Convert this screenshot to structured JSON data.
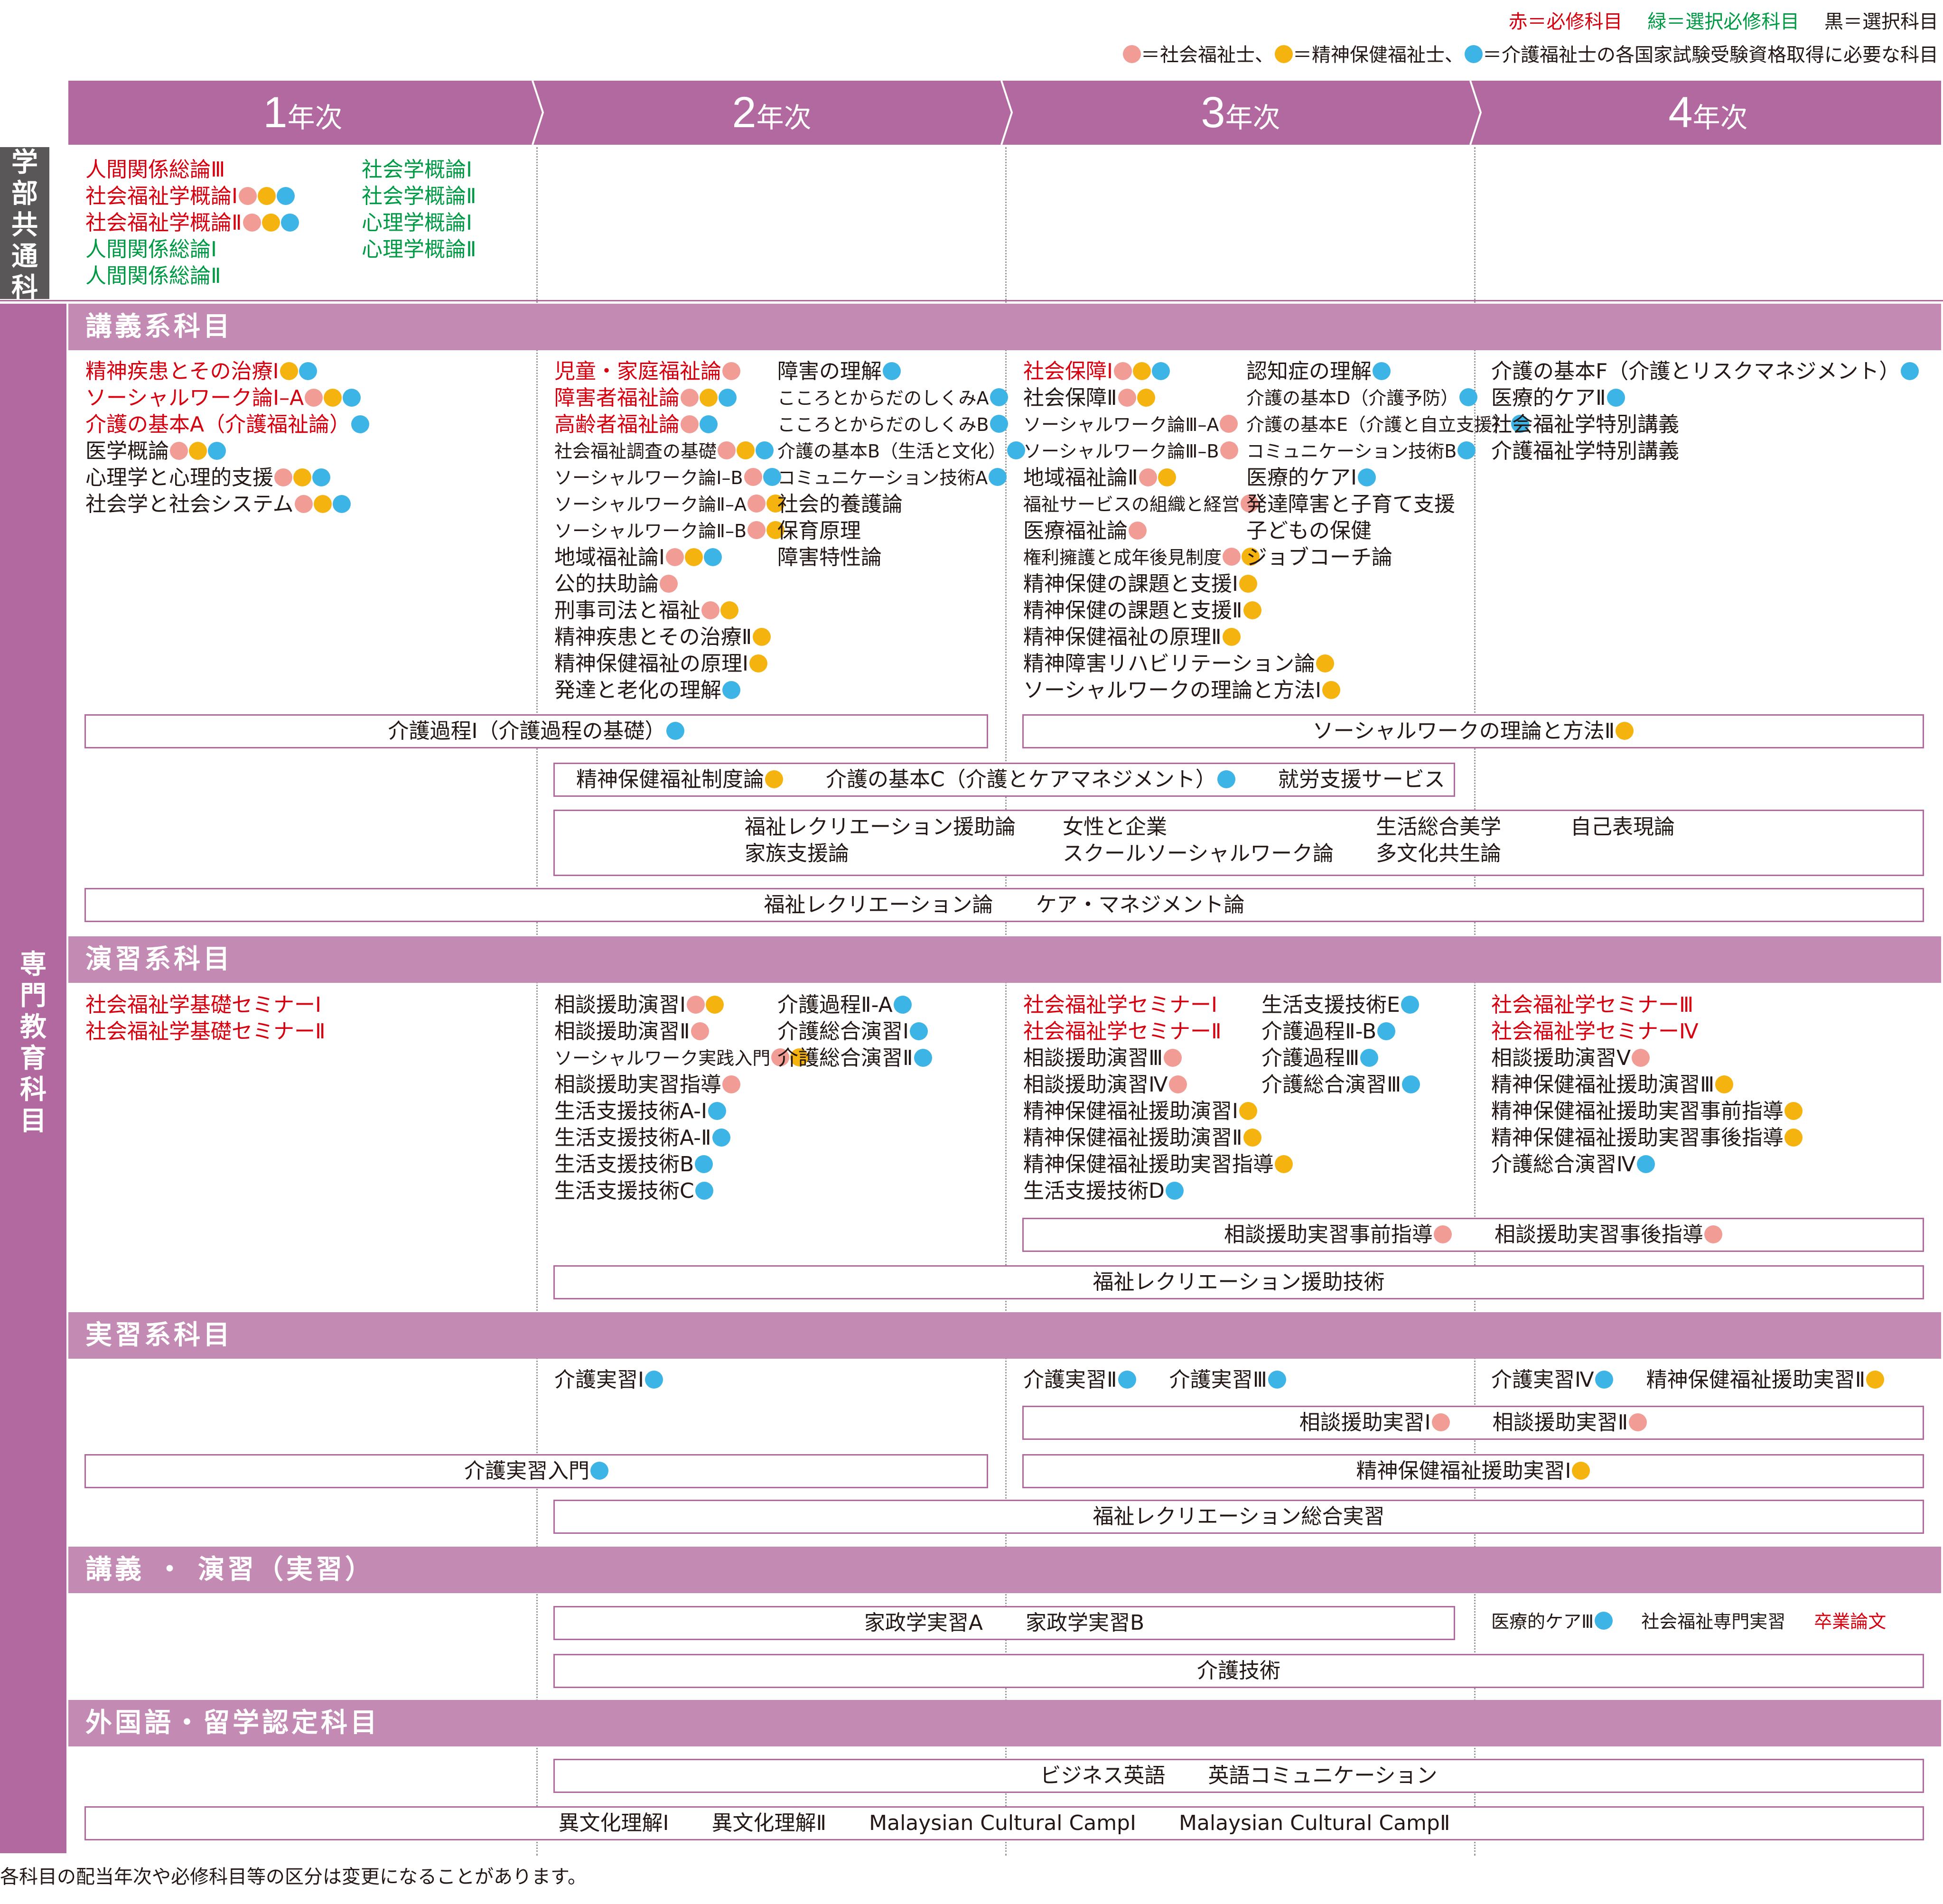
{
  "legend": {
    "line1": {
      "red": "赤＝必修科目",
      "green": "緑＝選択必修科目",
      "black": "黒＝選択科目"
    },
    "line2": {
      "pink_text": "＝社会福祉士、",
      "yellow_text": "＝精神保健福祉士、",
      "blue_text": "＝介護福祉士の各国家試験受験資格取得に必要な科目"
    }
  },
  "colors": {
    "required": "#d7000f",
    "elective_required": "#009a44",
    "elective": "#231815",
    "pink_dot": "#f19c94",
    "yellow_dot": "#f5b30f",
    "blue_dot": "#3db4e6",
    "header": "#b2699f",
    "category": "#c38ab4"
  },
  "dot_meaning": {
    "p": "社会福祉士",
    "y": "精神保健福祉士",
    "b": "介護福祉士"
  },
  "years": [
    {
      "num": "1",
      "suffix": "年次"
    },
    {
      "num": "2",
      "suffix": "年次"
    },
    {
      "num": "3",
      "suffix": "年次"
    },
    {
      "num": "4",
      "suffix": "年次"
    }
  ],
  "side": {
    "common": "学部共通科目",
    "specialized": "専門教育科目"
  },
  "common": {
    "col1": [
      {
        "t": "人間関係総論Ⅲ",
        "c": "r",
        "d": ""
      },
      {
        "t": "社会福祉学概論Ⅰ",
        "c": "r",
        "d": "pyb"
      },
      {
        "t": "社会福祉学概論Ⅱ",
        "c": "r",
        "d": "pyb"
      },
      {
        "t": "人間関係総論Ⅰ",
        "c": "g",
        "d": ""
      },
      {
        "t": "人間関係総論Ⅱ",
        "c": "g",
        "d": ""
      }
    ],
    "col2": [
      {
        "t": "社会学概論Ⅰ",
        "c": "g",
        "d": ""
      },
      {
        "t": "社会学概論Ⅱ",
        "c": "g",
        "d": ""
      },
      {
        "t": "心理学概論Ⅰ",
        "c": "g",
        "d": ""
      },
      {
        "t": "心理学概論Ⅱ",
        "c": "g",
        "d": ""
      }
    ]
  },
  "categories": [
    "講義系科目",
    "演習系科目",
    "実習系科目",
    "講義 ・ 演習（実習）",
    "外国語・留学認定科目"
  ],
  "lecture": {
    "y1": [
      {
        "t": "精神疾患とその治療Ⅰ",
        "c": "r",
        "d": "yb"
      },
      {
        "t": "ソーシャルワーク論Ⅰ–A",
        "c": "r",
        "d": "pyb"
      },
      {
        "t": "介護の基本A（介護福祉論）",
        "c": "r",
        "d": "b"
      },
      {
        "t": "医学概論",
        "c": "",
        "d": "pyb"
      },
      {
        "t": "心理学と心理的支援",
        "c": "",
        "d": "pyb"
      },
      {
        "t": "社会学と社会システム",
        "c": "",
        "d": "pyb"
      }
    ],
    "y2a": [
      {
        "t": "児童・家庭福祉論",
        "c": "r",
        "d": "p"
      },
      {
        "t": "障害者福祉論",
        "c": "r",
        "d": "pyb"
      },
      {
        "t": "高齢者福祉論",
        "c": "r",
        "d": "pb"
      },
      {
        "t": "社会福祉調査の基礎",
        "c": "",
        "d": "pyb",
        "s": 1
      },
      {
        "t": "ソーシャルワーク論Ⅰ–B",
        "c": "",
        "d": "pb",
        "s": 1
      },
      {
        "t": "ソーシャルワーク論Ⅱ–A",
        "c": "",
        "d": "py",
        "s": 1
      },
      {
        "t": "ソーシャルワーク論Ⅱ–B",
        "c": "",
        "d": "py",
        "s": 1
      },
      {
        "t": "地域福祉論Ⅰ",
        "c": "",
        "d": "pyb"
      },
      {
        "t": "公的扶助論",
        "c": "",
        "d": "p"
      },
      {
        "t": "刑事司法と福祉",
        "c": "",
        "d": "py"
      },
      {
        "t": "精神疾患とその治療Ⅱ",
        "c": "",
        "d": "y"
      },
      {
        "t": "精神保健福祉の原理Ⅰ",
        "c": "",
        "d": "y"
      },
      {
        "t": "発達と老化の理解",
        "c": "",
        "d": "b"
      }
    ],
    "y2b": [
      {
        "t": "障害の理解",
        "c": "",
        "d": "b"
      },
      {
        "t": "こころとからだのしくみA",
        "c": "",
        "d": "b",
        "s": 1
      },
      {
        "t": "こころとからだのしくみB",
        "c": "",
        "d": "b",
        "s": 1
      },
      {
        "t": "介護の基本B（生活と文化）",
        "c": "",
        "d": "b",
        "s": 1
      },
      {
        "t": "コミュニケーション技術A",
        "c": "",
        "d": "b",
        "s": 1
      },
      {
        "t": "社会的養護論",
        "c": "",
        "d": ""
      },
      {
        "t": "保育原理",
        "c": "",
        "d": ""
      },
      {
        "t": "障害特性論",
        "c": "",
        "d": ""
      }
    ],
    "y3a": [
      {
        "t": "社会保障Ⅰ",
        "c": "r",
        "d": "pyb"
      },
      {
        "t": "社会保障Ⅱ",
        "c": "",
        "d": "py"
      },
      {
        "t": "ソーシャルワーク論Ⅲ–A",
        "c": "",
        "d": "p",
        "s": 1
      },
      {
        "t": "ソーシャルワーク論Ⅲ–B",
        "c": "",
        "d": "p",
        "s": 1
      },
      {
        "t": "地域福祉論Ⅱ",
        "c": "",
        "d": "py"
      },
      {
        "t": "福祉サービスの組織と経営",
        "c": "",
        "d": "p",
        "s": 1
      },
      {
        "t": "医療福祉論",
        "c": "",
        "d": "p"
      },
      {
        "t": "権利擁護と成年後見制度",
        "c": "",
        "d": "py",
        "s": 1
      },
      {
        "t": "精神保健の課題と支援Ⅰ",
        "c": "",
        "d": "y"
      },
      {
        "t": "精神保健の課題と支援Ⅱ",
        "c": "",
        "d": "y"
      },
      {
        "t": "精神保健福祉の原理Ⅱ",
        "c": "",
        "d": "y"
      },
      {
        "t": "精神障害リハビリテーション論",
        "c": "",
        "d": "y"
      },
      {
        "t": "ソーシャルワークの理論と方法Ⅰ",
        "c": "",
        "d": "y"
      }
    ],
    "y3b": [
      {
        "t": "認知症の理解",
        "c": "",
        "d": "b"
      },
      {
        "t": "介護の基本D（介護予防）",
        "c": "",
        "d": "b",
        "s": 1
      },
      {
        "t": "介護の基本E（介護と自立支援）",
        "c": "",
        "d": "b",
        "s": 1
      },
      {
        "t": "コミュニケーション技術B",
        "c": "",
        "d": "b",
        "s": 1
      },
      {
        "t": "医療的ケアⅠ",
        "c": "",
        "d": "b"
      },
      {
        "t": "発達障害と子育て支援",
        "c": "",
        "d": ""
      },
      {
        "t": "子どもの保健",
        "c": "",
        "d": ""
      },
      {
        "t": "ジョブコーチ論",
        "c": "",
        "d": ""
      }
    ],
    "y4": [
      {
        "t": "介護の基本F（介護とリスクマネジメント）",
        "c": "",
        "d": "b"
      },
      {
        "t": "医療的ケアⅡ",
        "c": "",
        "d": "b"
      },
      {
        "t": "社会福祉学特別講義",
        "c": "",
        "d": ""
      },
      {
        "t": "介護福祉学特別講義",
        "c": "",
        "d": ""
      }
    ],
    "boxes": {
      "kaigo_katei": {
        "t": "介護過程Ⅰ（介護過程の基礎）",
        "d": "b"
      },
      "sw_theory2": {
        "t": "ソーシャルワークの理論と方法Ⅱ",
        "d": "y"
      },
      "row2": [
        {
          "t": "精神保健福祉制度論",
          "d": "y"
        },
        {
          "t": "介護の基本C（介護とケアマネジメント）",
          "d": "b"
        },
        {
          "t": "就労支援サービス",
          "d": ""
        }
      ],
      "row3a": [
        "福祉レクリエーション援助論",
        "女性と企業",
        "生活総合美学",
        "自己表現論"
      ],
      "row3b": [
        "家族支援論",
        "スクールソーシャルワーク論",
        "多文化共生論"
      ],
      "row4": [
        "福祉レクリエーション論",
        "ケア・マネジメント論"
      ]
    }
  },
  "seminar": {
    "y1": [
      {
        "t": "社会福祉学基礎セミナーⅠ",
        "c": "r",
        "d": ""
      },
      {
        "t": "社会福祉学基礎セミナーⅡ",
        "c": "r",
        "d": ""
      }
    ],
    "y2a": [
      {
        "t": "相談援助演習Ⅰ",
        "c": "",
        "d": "py"
      },
      {
        "t": "相談援助演習Ⅱ",
        "c": "",
        "d": "p"
      },
      {
        "t": "ソーシャルワーク実践入門",
        "c": "",
        "d": "py",
        "s": 1
      },
      {
        "t": "相談援助実習指導",
        "c": "",
        "d": "p"
      },
      {
        "t": "生活支援技術A-Ⅰ",
        "c": "",
        "d": "b"
      },
      {
        "t": "生活支援技術A-Ⅱ",
        "c": "",
        "d": "b"
      },
      {
        "t": "生活支援技術B",
        "c": "",
        "d": "b"
      },
      {
        "t": "生活支援技術C",
        "c": "",
        "d": "b"
      }
    ],
    "y2b": [
      {
        "t": "介護過程Ⅱ-A",
        "c": "",
        "d": "b"
      },
      {
        "t": "介護総合演習Ⅰ",
        "c": "",
        "d": "b"
      },
      {
        "t": "介護総合演習Ⅱ",
        "c": "",
        "d": "b"
      }
    ],
    "y3a": [
      {
        "t": "社会福祉学セミナーⅠ",
        "c": "r",
        "d": ""
      },
      {
        "t": "社会福祉学セミナーⅡ",
        "c": "r",
        "d": ""
      },
      {
        "t": "相談援助演習Ⅲ",
        "c": "",
        "d": "p"
      },
      {
        "t": "相談援助演習Ⅳ",
        "c": "",
        "d": "p"
      },
      {
        "t": "精神保健福祉援助演習Ⅰ",
        "c": "",
        "d": "y"
      },
      {
        "t": "精神保健福祉援助演習Ⅱ",
        "c": "",
        "d": "y"
      },
      {
        "t": "精神保健福祉援助実習指導",
        "c": "",
        "d": "y"
      },
      {
        "t": "生活支援技術D",
        "c": "",
        "d": "b"
      }
    ],
    "y3b": [
      {
        "t": "生活支援技術E",
        "c": "",
        "d": "b"
      },
      {
        "t": "介護過程Ⅱ-B",
        "c": "",
        "d": "b"
      },
      {
        "t": "介護過程Ⅲ",
        "c": "",
        "d": "b"
      },
      {
        "t": "介護総合演習Ⅲ",
        "c": "",
        "d": "b"
      }
    ],
    "y4": [
      {
        "t": "社会福祉学セミナーⅢ",
        "c": "r",
        "d": ""
      },
      {
        "t": "社会福祉学セミナーⅣ",
        "c": "r",
        "d": ""
      },
      {
        "t": "相談援助演習Ⅴ",
        "c": "",
        "d": "p"
      },
      {
        "t": "精神保健福祉援助演習Ⅲ",
        "c": "",
        "d": "y"
      },
      {
        "t": "精神保健福祉援助実習事前指導",
        "c": "",
        "d": "y"
      },
      {
        "t": "精神保健福祉援助実習事後指導",
        "c": "",
        "d": "y"
      },
      {
        "t": "介護総合演習Ⅳ",
        "c": "",
        "d": "b"
      }
    ],
    "boxes": {
      "row1": [
        {
          "t": "相談援助実習事前指導",
          "d": "p"
        },
        {
          "t": "相談援助実習事後指導",
          "d": "p"
        }
      ],
      "row2": "福祉レクリエーション援助技術"
    }
  },
  "practicum": {
    "y2": {
      "t": "介護実習Ⅰ",
      "d": "b"
    },
    "y3": [
      {
        "t": "介護実習Ⅱ",
        "d": "b"
      },
      {
        "t": "介護実習Ⅲ",
        "d": "b"
      }
    ],
    "y4": [
      {
        "t": "介護実習Ⅳ",
        "d": "b"
      },
      {
        "t": "精神保健福祉援助実習Ⅱ",
        "d": "y"
      }
    ],
    "boxes": {
      "soudan": [
        {
          "t": "相談援助実習Ⅰ",
          "d": "p"
        },
        {
          "t": "相談援助実習Ⅱ",
          "d": "p"
        }
      ],
      "intro": {
        "t": "介護実習入門",
        "d": "b"
      },
      "seishin1": {
        "t": "精神保健福祉援助実習Ⅰ",
        "d": "y"
      },
      "rec": "福祉レクリエーション総合実習"
    }
  },
  "mixed": {
    "y4": [
      {
        "t": "医療的ケアⅢ",
        "c": "",
        "d": "b",
        "s": 1
      },
      {
        "t": "社会福祉専門実習",
        "c": "",
        "d": "",
        "s": 1
      },
      {
        "t": "卒業論文",
        "c": "r",
        "d": "",
        "s": 1
      }
    ],
    "boxes": {
      "kasei": [
        "家政学実習A",
        "家政学実習B"
      ],
      "kaigo": "介護技術"
    }
  },
  "foreign": {
    "boxes": {
      "row1": [
        "ビジネス英語",
        "英語コミュニケーション"
      ],
      "row2": [
        "異文化理解Ⅰ",
        "異文化理解Ⅱ",
        "Malaysian Cultural CampⅠ",
        "Malaysian Cultural CampⅡ"
      ]
    }
  },
  "note": "各科目の配当年次や必修科目等の区分は変更になることがあります。"
}
